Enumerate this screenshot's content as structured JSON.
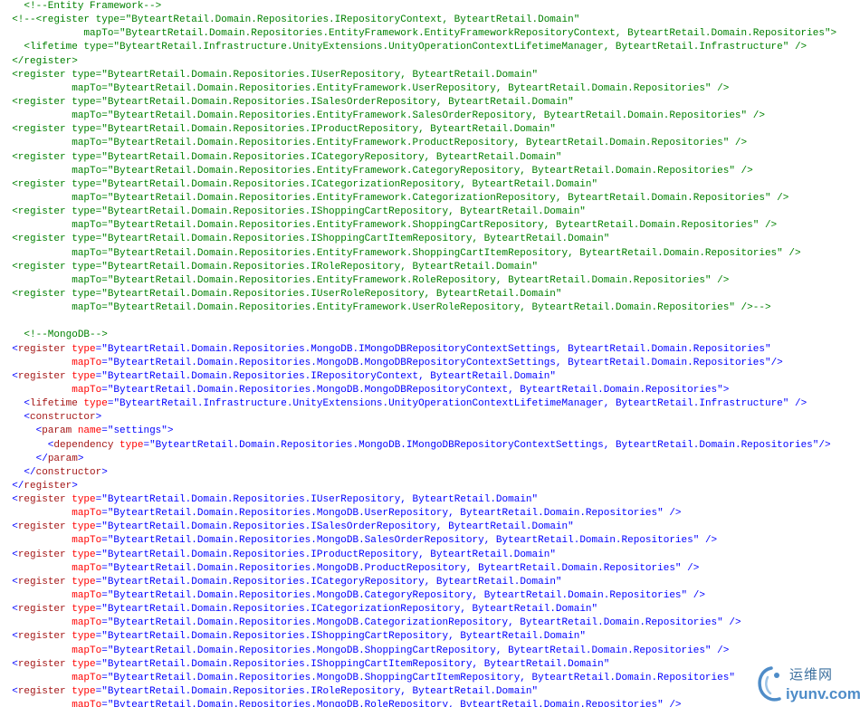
{
  "colors": {
    "comment": "#008000",
    "punctuation": "#0000ff",
    "tag": "#a31515",
    "attribute": "#ff0000",
    "value": "#0000ff",
    "background": "#ffffff"
  },
  "code_lines": [
    [
      {
        "k": "comment",
        "t": "    <!--Entity Framework-->"
      }
    ],
    [
      {
        "k": "comment",
        "t": "  <!--<register type=\"ByteartRetail.Domain.Repositories.IRepositoryContext, ByteartRetail.Domain\""
      }
    ],
    [
      {
        "k": "comment",
        "t": "              mapTo=\"ByteartRetail.Domain.Repositories.EntityFramework.EntityFrameworkRepositoryContext, ByteartRetail.Domain.Repositories\">"
      }
    ],
    [
      {
        "k": "comment",
        "t": "    <lifetime type=\"ByteartRetail.Infrastructure.UnityExtensions.UnityOperationContextLifetimeManager, ByteartRetail.Infrastructure\" />"
      }
    ],
    [
      {
        "k": "comment",
        "t": "  </register>"
      }
    ],
    [
      {
        "k": "comment",
        "t": "  <register type=\"ByteartRetail.Domain.Repositories.IUserRepository, ByteartRetail.Domain\""
      }
    ],
    [
      {
        "k": "comment",
        "t": "            mapTo=\"ByteartRetail.Domain.Repositories.EntityFramework.UserRepository, ByteartRetail.Domain.Repositories\" />"
      }
    ],
    [
      {
        "k": "comment",
        "t": "  <register type=\"ByteartRetail.Domain.Repositories.ISalesOrderRepository, ByteartRetail.Domain\""
      }
    ],
    [
      {
        "k": "comment",
        "t": "            mapTo=\"ByteartRetail.Domain.Repositories.EntityFramework.SalesOrderRepository, ByteartRetail.Domain.Repositories\" />"
      }
    ],
    [
      {
        "k": "comment",
        "t": "  <register type=\"ByteartRetail.Domain.Repositories.IProductRepository, ByteartRetail.Domain\""
      }
    ],
    [
      {
        "k": "comment",
        "t": "            mapTo=\"ByteartRetail.Domain.Repositories.EntityFramework.ProductRepository, ByteartRetail.Domain.Repositories\" />"
      }
    ],
    [
      {
        "k": "comment",
        "t": "  <register type=\"ByteartRetail.Domain.Repositories.ICategoryRepository, ByteartRetail.Domain\""
      }
    ],
    [
      {
        "k": "comment",
        "t": "            mapTo=\"ByteartRetail.Domain.Repositories.EntityFramework.CategoryRepository, ByteartRetail.Domain.Repositories\" />"
      }
    ],
    [
      {
        "k": "comment",
        "t": "  <register type=\"ByteartRetail.Domain.Repositories.ICategorizationRepository, ByteartRetail.Domain\""
      }
    ],
    [
      {
        "k": "comment",
        "t": "            mapTo=\"ByteartRetail.Domain.Repositories.EntityFramework.CategorizationRepository, ByteartRetail.Domain.Repositories\" />"
      }
    ],
    [
      {
        "k": "comment",
        "t": "  <register type=\"ByteartRetail.Domain.Repositories.IShoppingCartRepository, ByteartRetail.Domain\""
      }
    ],
    [
      {
        "k": "comment",
        "t": "            mapTo=\"ByteartRetail.Domain.Repositories.EntityFramework.ShoppingCartRepository, ByteartRetail.Domain.Repositories\" />"
      }
    ],
    [
      {
        "k": "comment",
        "t": "  <register type=\"ByteartRetail.Domain.Repositories.IShoppingCartItemRepository, ByteartRetail.Domain\""
      }
    ],
    [
      {
        "k": "comment",
        "t": "            mapTo=\"ByteartRetail.Domain.Repositories.EntityFramework.ShoppingCartItemRepository, ByteartRetail.Domain.Repositories\" />"
      }
    ],
    [
      {
        "k": "comment",
        "t": "  <register type=\"ByteartRetail.Domain.Repositories.IRoleRepository, ByteartRetail.Domain\""
      }
    ],
    [
      {
        "k": "comment",
        "t": "            mapTo=\"ByteartRetail.Domain.Repositories.EntityFramework.RoleRepository, ByteartRetail.Domain.Repositories\" />"
      }
    ],
    [
      {
        "k": "comment",
        "t": "  <register type=\"ByteartRetail.Domain.Repositories.IUserRoleRepository, ByteartRetail.Domain\""
      }
    ],
    [
      {
        "k": "comment",
        "t": "            mapTo=\"ByteartRetail.Domain.Repositories.EntityFramework.UserRoleRepository, ByteartRetail.Domain.Repositories\" />-->"
      }
    ],
    [],
    [
      {
        "k": "comment",
        "t": "    <!--MongoDB-->"
      }
    ],
    [
      {
        "k": "punct",
        "t": "  <"
      },
      {
        "k": "tag",
        "t": "register"
      },
      {
        "k": "attr",
        "t": " type"
      },
      {
        "k": "punct",
        "t": "="
      },
      {
        "k": "value",
        "t": "\"ByteartRetail.Domain.Repositories.MongoDB.IMongoDBRepositoryContextSettings, ByteartRetail.Domain.Repositories\""
      }
    ],
    [
      {
        "k": "attr",
        "t": "            mapTo"
      },
      {
        "k": "punct",
        "t": "="
      },
      {
        "k": "value",
        "t": "\"ByteartRetail.Domain.Repositories.MongoDB.MongoDBRepositoryContextSettings, ByteartRetail.Domain.Repositories\""
      },
      {
        "k": "punct",
        "t": "/>"
      }
    ],
    [
      {
        "k": "punct",
        "t": "  <"
      },
      {
        "k": "tag",
        "t": "register"
      },
      {
        "k": "attr",
        "t": " type"
      },
      {
        "k": "punct",
        "t": "="
      },
      {
        "k": "value",
        "t": "\"ByteartRetail.Domain.Repositories.IRepositoryContext, ByteartRetail.Domain\""
      }
    ],
    [
      {
        "k": "attr",
        "t": "            mapTo"
      },
      {
        "k": "punct",
        "t": "="
      },
      {
        "k": "value",
        "t": "\"ByteartRetail.Domain.Repositories.MongoDB.MongoDBRepositoryContext, ByteartRetail.Domain.Repositories\""
      },
      {
        "k": "punct",
        "t": ">"
      }
    ],
    [
      {
        "k": "punct",
        "t": "    <"
      },
      {
        "k": "tag",
        "t": "lifetime"
      },
      {
        "k": "attr",
        "t": " type"
      },
      {
        "k": "punct",
        "t": "="
      },
      {
        "k": "value",
        "t": "\"ByteartRetail.Infrastructure.UnityExtensions.UnityOperationContextLifetimeManager, ByteartRetail.Infrastructure\""
      },
      {
        "k": "punct",
        "t": " />"
      }
    ],
    [
      {
        "k": "punct",
        "t": "    <"
      },
      {
        "k": "tag",
        "t": "constructor"
      },
      {
        "k": "punct",
        "t": ">"
      }
    ],
    [
      {
        "k": "punct",
        "t": "      <"
      },
      {
        "k": "tag",
        "t": "param"
      },
      {
        "k": "attr",
        "t": " name"
      },
      {
        "k": "punct",
        "t": "="
      },
      {
        "k": "value",
        "t": "\"settings\""
      },
      {
        "k": "punct",
        "t": ">"
      }
    ],
    [
      {
        "k": "punct",
        "t": "        <"
      },
      {
        "k": "tag",
        "t": "dependency"
      },
      {
        "k": "attr",
        "t": " type"
      },
      {
        "k": "punct",
        "t": "="
      },
      {
        "k": "value",
        "t": "\"ByteartRetail.Domain.Repositories.MongoDB.IMongoDBRepositoryContextSettings, ByteartRetail.Domain.Repositories\""
      },
      {
        "k": "punct",
        "t": "/>"
      }
    ],
    [
      {
        "k": "punct",
        "t": "      </"
      },
      {
        "k": "tag",
        "t": "param"
      },
      {
        "k": "punct",
        "t": ">"
      }
    ],
    [
      {
        "k": "punct",
        "t": "    </"
      },
      {
        "k": "tag",
        "t": "constructor"
      },
      {
        "k": "punct",
        "t": ">"
      }
    ],
    [
      {
        "k": "punct",
        "t": "  </"
      },
      {
        "k": "tag",
        "t": "register"
      },
      {
        "k": "punct",
        "t": ">"
      }
    ],
    [
      {
        "k": "punct",
        "t": "  <"
      },
      {
        "k": "tag",
        "t": "register"
      },
      {
        "k": "attr",
        "t": " type"
      },
      {
        "k": "punct",
        "t": "="
      },
      {
        "k": "value",
        "t": "\"ByteartRetail.Domain.Repositories.IUserRepository, ByteartRetail.Domain\""
      }
    ],
    [
      {
        "k": "attr",
        "t": "            mapTo"
      },
      {
        "k": "punct",
        "t": "="
      },
      {
        "k": "value",
        "t": "\"ByteartRetail.Domain.Repositories.MongoDB.UserRepository, ByteartRetail.Domain.Repositories\""
      },
      {
        "k": "punct",
        "t": " />"
      }
    ],
    [
      {
        "k": "punct",
        "t": "  <"
      },
      {
        "k": "tag",
        "t": "register"
      },
      {
        "k": "attr",
        "t": " type"
      },
      {
        "k": "punct",
        "t": "="
      },
      {
        "k": "value",
        "t": "\"ByteartRetail.Domain.Repositories.ISalesOrderRepository, ByteartRetail.Domain\""
      }
    ],
    [
      {
        "k": "attr",
        "t": "            mapTo"
      },
      {
        "k": "punct",
        "t": "="
      },
      {
        "k": "value",
        "t": "\"ByteartRetail.Domain.Repositories.MongoDB.SalesOrderRepository, ByteartRetail.Domain.Repositories\""
      },
      {
        "k": "punct",
        "t": " />"
      }
    ],
    [
      {
        "k": "punct",
        "t": "  <"
      },
      {
        "k": "tag",
        "t": "register"
      },
      {
        "k": "attr",
        "t": " type"
      },
      {
        "k": "punct",
        "t": "="
      },
      {
        "k": "value",
        "t": "\"ByteartRetail.Domain.Repositories.IProductRepository, ByteartRetail.Domain\""
      }
    ],
    [
      {
        "k": "attr",
        "t": "            mapTo"
      },
      {
        "k": "punct",
        "t": "="
      },
      {
        "k": "value",
        "t": "\"ByteartRetail.Domain.Repositories.MongoDB.ProductRepository, ByteartRetail.Domain.Repositories\""
      },
      {
        "k": "punct",
        "t": " />"
      }
    ],
    [
      {
        "k": "punct",
        "t": "  <"
      },
      {
        "k": "tag",
        "t": "register"
      },
      {
        "k": "attr",
        "t": " type"
      },
      {
        "k": "punct",
        "t": "="
      },
      {
        "k": "value",
        "t": "\"ByteartRetail.Domain.Repositories.ICategoryRepository, ByteartRetail.Domain\""
      }
    ],
    [
      {
        "k": "attr",
        "t": "            mapTo"
      },
      {
        "k": "punct",
        "t": "="
      },
      {
        "k": "value",
        "t": "\"ByteartRetail.Domain.Repositories.MongoDB.CategoryRepository, ByteartRetail.Domain.Repositories\""
      },
      {
        "k": "punct",
        "t": " />"
      }
    ],
    [
      {
        "k": "punct",
        "t": "  <"
      },
      {
        "k": "tag",
        "t": "register"
      },
      {
        "k": "attr",
        "t": " type"
      },
      {
        "k": "punct",
        "t": "="
      },
      {
        "k": "value",
        "t": "\"ByteartRetail.Domain.Repositories.ICategorizationRepository, ByteartRetail.Domain\""
      }
    ],
    [
      {
        "k": "attr",
        "t": "            mapTo"
      },
      {
        "k": "punct",
        "t": "="
      },
      {
        "k": "value",
        "t": "\"ByteartRetail.Domain.Repositories.MongoDB.CategorizationRepository, ByteartRetail.Domain.Repositories\""
      },
      {
        "k": "punct",
        "t": " />"
      }
    ],
    [
      {
        "k": "punct",
        "t": "  <"
      },
      {
        "k": "tag",
        "t": "register"
      },
      {
        "k": "attr",
        "t": " type"
      },
      {
        "k": "punct",
        "t": "="
      },
      {
        "k": "value",
        "t": "\"ByteartRetail.Domain.Repositories.IShoppingCartRepository, ByteartRetail.Domain\""
      }
    ],
    [
      {
        "k": "attr",
        "t": "            mapTo"
      },
      {
        "k": "punct",
        "t": "="
      },
      {
        "k": "value",
        "t": "\"ByteartRetail.Domain.Repositories.MongoDB.ShoppingCartRepository, ByteartRetail.Domain.Repositories\""
      },
      {
        "k": "punct",
        "t": " />"
      }
    ],
    [
      {
        "k": "punct",
        "t": "  <"
      },
      {
        "k": "tag",
        "t": "register"
      },
      {
        "k": "attr",
        "t": " type"
      },
      {
        "k": "punct",
        "t": "="
      },
      {
        "k": "value",
        "t": "\"ByteartRetail.Domain.Repositories.IShoppingCartItemRepository, ByteartRetail.Domain\""
      }
    ],
    [
      {
        "k": "attr",
        "t": "            mapTo"
      },
      {
        "k": "punct",
        "t": "="
      },
      {
        "k": "value",
        "t": "\"ByteartRetail.Domain.Repositories.MongoDB.ShoppingCartItemRepository, ByteartRetail.Domain.Repositories\""
      }
    ],
    [
      {
        "k": "punct",
        "t": "  <"
      },
      {
        "k": "tag",
        "t": "register"
      },
      {
        "k": "attr",
        "t": " type"
      },
      {
        "k": "punct",
        "t": "="
      },
      {
        "k": "value",
        "t": "\"ByteartRetail.Domain.Repositories.IRoleRepository, ByteartRetail.Domain\""
      }
    ],
    [
      {
        "k": "attr",
        "t": "            mapTo"
      },
      {
        "k": "punct",
        "t": "="
      },
      {
        "k": "value",
        "t": "\"ByteartRetail.Domain.Repositories.MongoDB.RoleRepository, ByteartRetail.Domain.Repositories\""
      },
      {
        "k": "punct",
        "t": " />"
      }
    ]
  ],
  "watermark": {
    "name_cn": "运维网",
    "url": "iyunv.com"
  }
}
